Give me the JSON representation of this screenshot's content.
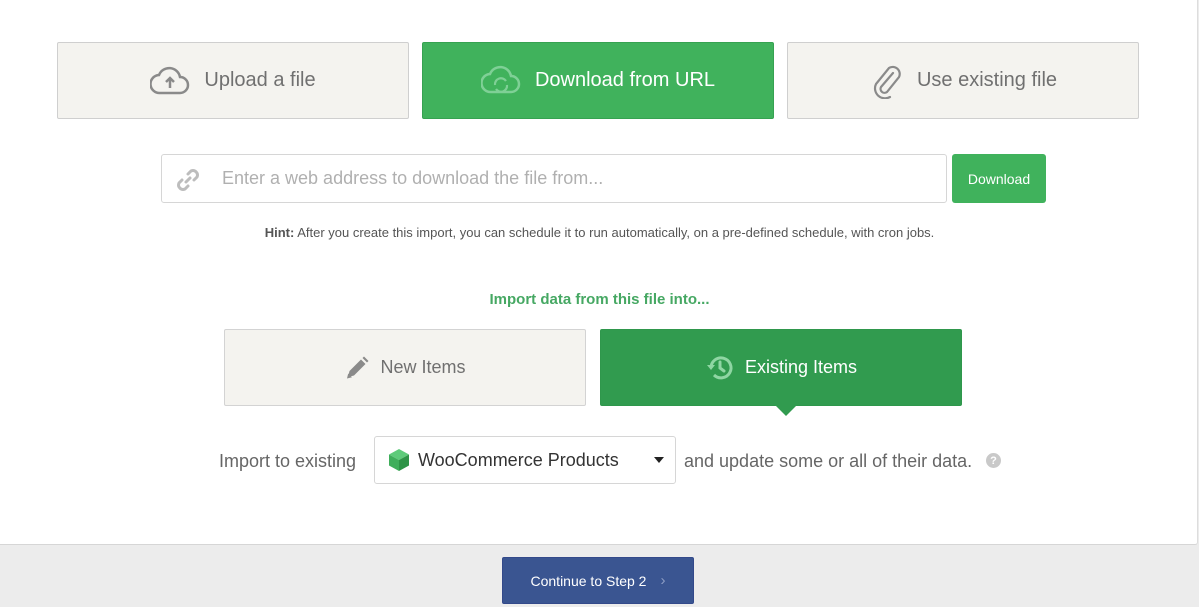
{
  "source_options": [
    {
      "label": "Upload a file",
      "icon": "cloud-upload-icon",
      "active": false
    },
    {
      "label": "Download from URL",
      "icon": "cloud-sync-icon",
      "active": true
    },
    {
      "label": "Use existing file",
      "icon": "paperclip-icon",
      "active": false
    }
  ],
  "url_input": {
    "value": "",
    "placeholder": "Enter a web address to download the file from..."
  },
  "download_button": {
    "label": "Download"
  },
  "hint": {
    "prefix": "Hint:",
    "text": " After you create this import, you can schedule it to run automatically, on a pre-defined schedule, with cron jobs."
  },
  "import_into": {
    "title": "Import data from this file into...",
    "options": [
      {
        "label": "New Items",
        "icon": "pencil-icon",
        "active": false
      },
      {
        "label": "Existing Items",
        "icon": "history-icon",
        "active": true
      }
    ]
  },
  "import_row": {
    "prefix": "Import to existing",
    "selected": "WooCommerce Products",
    "suffix": "and update some or all of their data.",
    "help": "?"
  },
  "continue_button": {
    "label": "Continue to Step 2",
    "chevron": "›"
  },
  "colors": {
    "green": "#40b25c",
    "dark_green": "#319b4f",
    "title_green": "#46a863",
    "blue": "#3a5591",
    "neutral_bg": "#f4f3ef"
  }
}
